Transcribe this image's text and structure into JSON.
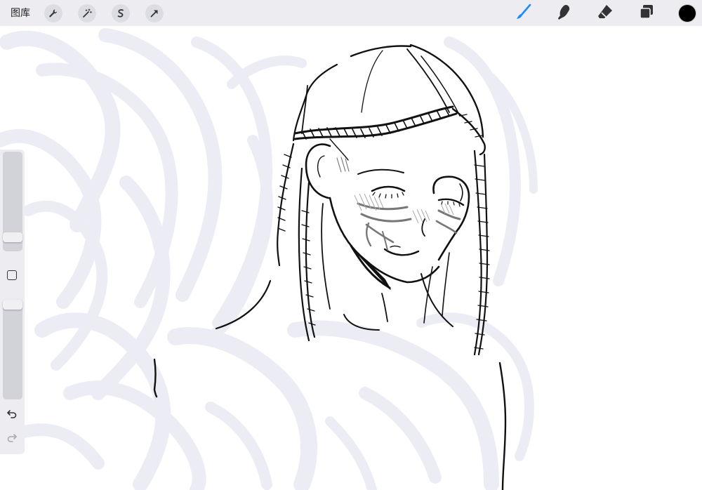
{
  "toolbar": {
    "gallery_label": "图库",
    "left_tools": [
      {
        "name": "actions",
        "icon": "wrench-icon"
      },
      {
        "name": "adjustments",
        "icon": "magic-wand-icon"
      },
      {
        "name": "selection",
        "icon": "selection-s-icon"
      },
      {
        "name": "transform",
        "icon": "arrow-cursor-icon"
      }
    ],
    "right_tools": [
      {
        "name": "brush",
        "icon": "brush-icon",
        "active": true
      },
      {
        "name": "smudge",
        "icon": "smudge-finger-icon",
        "active": false
      },
      {
        "name": "eraser",
        "icon": "eraser-icon",
        "active": false
      },
      {
        "name": "layers",
        "icon": "layers-icon",
        "active": false
      }
    ],
    "current_color": "#000000",
    "active_tool_color": "#1a8cff"
  },
  "sidebar": {
    "brush_size_level": 0.9,
    "opacity_level": 0.0,
    "undo_icon": "undo-arrow-icon",
    "redo_icon": "redo-arrow-icon"
  },
  "canvas": {
    "artwork": "line-drawing-of-girl-with-braided-headband",
    "background_strokes_color": "#ecedf4",
    "line_color": "#111111"
  }
}
